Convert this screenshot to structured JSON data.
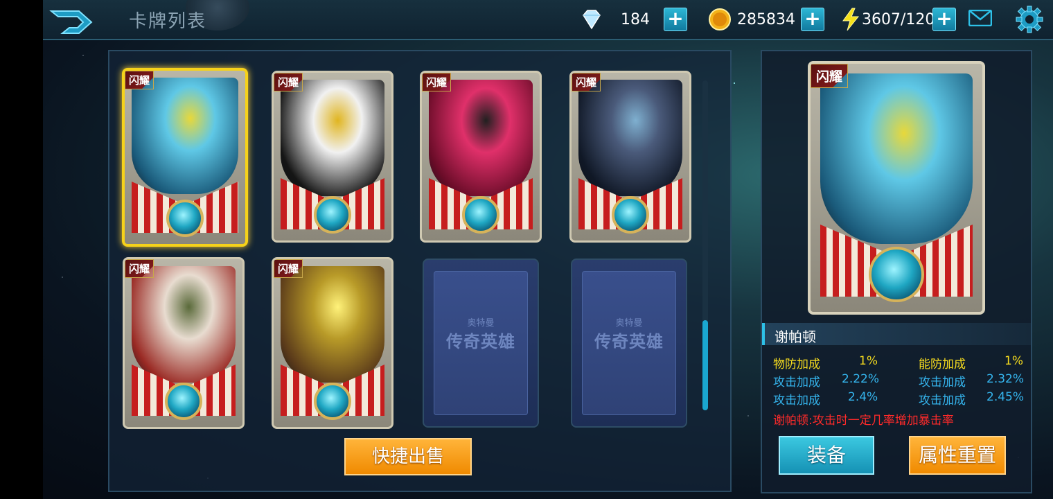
{
  "header": {
    "title": "卡牌列表",
    "diamonds": "184",
    "gold": "285834",
    "energy": "3607/120"
  },
  "cards": [
    {
      "badge": "闪耀",
      "art_colors": [
        "#5fc8e6",
        "#1a5a7a",
        "#e8d83a"
      ]
    },
    {
      "badge": "闪耀",
      "art_colors": [
        "#f1f1f1",
        "#151515",
        "#e0b520"
      ]
    },
    {
      "badge": "闪耀",
      "art_colors": [
        "#e0306a",
        "#6a0c28",
        "#202020"
      ]
    },
    {
      "badge": "闪耀",
      "art_colors": [
        "#4a5a7a",
        "#101826",
        "#7fb0d0"
      ]
    },
    {
      "badge": "闪耀",
      "art_colors": [
        "#e8dcd0",
        "#9a2a24",
        "#5a6a3a"
      ]
    },
    {
      "badge": "闪耀",
      "art_colors": [
        "#b89a28",
        "#5a3a1a",
        "#fff27a"
      ]
    }
  ],
  "empty_slots": [
    {
      "line1": "奥特曼",
      "line2": "传奇英雄"
    },
    {
      "line1": "奥特曼",
      "line2": "传奇英雄"
    }
  ],
  "quick_sell_label": "快捷出售",
  "detail": {
    "badge": "闪耀",
    "name": "谢帕顿",
    "stats_left": [
      {
        "label": "物防加成",
        "value": "1%",
        "color": "yellow"
      },
      {
        "label": "攻击加成",
        "value": "2.22%",
        "color": "blue"
      },
      {
        "label": "攻击加成",
        "value": "2.4%",
        "color": "blue"
      }
    ],
    "stats_right": [
      {
        "label": "能防加成",
        "value": "1%",
        "color": "yellow"
      },
      {
        "label": "攻击加成",
        "value": "2.32%",
        "color": "blue"
      },
      {
        "label": "攻击加成",
        "value": "2.45%",
        "color": "blue"
      }
    ],
    "skill": "谢帕顿:攻击时一定几率增加暴击率",
    "equip_label": "装备",
    "reset_label": "属性重置"
  },
  "colors": {
    "accent_blue": "#1aa7d0",
    "accent_orange": "#f08a00",
    "select_gold": "#f6d21a"
  }
}
